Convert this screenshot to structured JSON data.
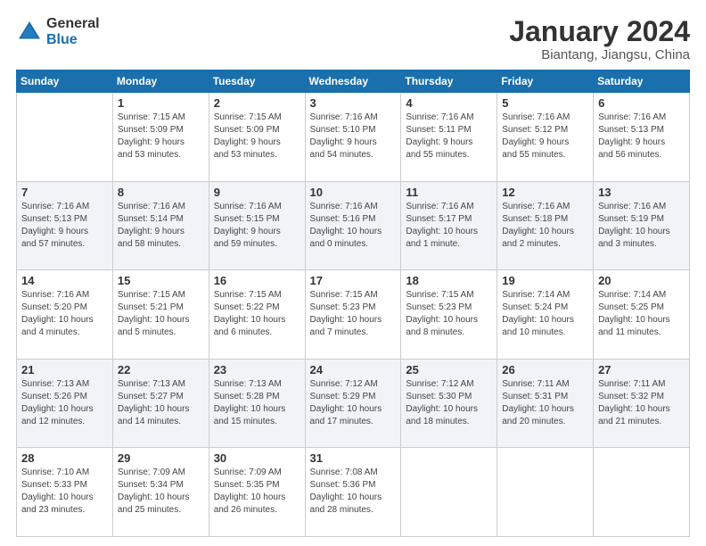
{
  "header": {
    "logo_general": "General",
    "logo_blue": "Blue",
    "month_title": "January 2024",
    "location": "Biantang, Jiangsu, China"
  },
  "days_of_week": [
    "Sunday",
    "Monday",
    "Tuesday",
    "Wednesday",
    "Thursday",
    "Friday",
    "Saturday"
  ],
  "weeks": [
    [
      {
        "day": "",
        "info": ""
      },
      {
        "day": "1",
        "info": "Sunrise: 7:15 AM\nSunset: 5:09 PM\nDaylight: 9 hours\nand 53 minutes."
      },
      {
        "day": "2",
        "info": "Sunrise: 7:15 AM\nSunset: 5:09 PM\nDaylight: 9 hours\nand 53 minutes."
      },
      {
        "day": "3",
        "info": "Sunrise: 7:16 AM\nSunset: 5:10 PM\nDaylight: 9 hours\nand 54 minutes."
      },
      {
        "day": "4",
        "info": "Sunrise: 7:16 AM\nSunset: 5:11 PM\nDaylight: 9 hours\nand 55 minutes."
      },
      {
        "day": "5",
        "info": "Sunrise: 7:16 AM\nSunset: 5:12 PM\nDaylight: 9 hours\nand 55 minutes."
      },
      {
        "day": "6",
        "info": "Sunrise: 7:16 AM\nSunset: 5:13 PM\nDaylight: 9 hours\nand 56 minutes."
      }
    ],
    [
      {
        "day": "7",
        "info": "Sunrise: 7:16 AM\nSunset: 5:13 PM\nDaylight: 9 hours\nand 57 minutes."
      },
      {
        "day": "8",
        "info": "Sunrise: 7:16 AM\nSunset: 5:14 PM\nDaylight: 9 hours\nand 58 minutes."
      },
      {
        "day": "9",
        "info": "Sunrise: 7:16 AM\nSunset: 5:15 PM\nDaylight: 9 hours\nand 59 minutes."
      },
      {
        "day": "10",
        "info": "Sunrise: 7:16 AM\nSunset: 5:16 PM\nDaylight: 10 hours\nand 0 minutes."
      },
      {
        "day": "11",
        "info": "Sunrise: 7:16 AM\nSunset: 5:17 PM\nDaylight: 10 hours\nand 1 minute."
      },
      {
        "day": "12",
        "info": "Sunrise: 7:16 AM\nSunset: 5:18 PM\nDaylight: 10 hours\nand 2 minutes."
      },
      {
        "day": "13",
        "info": "Sunrise: 7:16 AM\nSunset: 5:19 PM\nDaylight: 10 hours\nand 3 minutes."
      }
    ],
    [
      {
        "day": "14",
        "info": "Sunrise: 7:16 AM\nSunset: 5:20 PM\nDaylight: 10 hours\nand 4 minutes."
      },
      {
        "day": "15",
        "info": "Sunrise: 7:15 AM\nSunset: 5:21 PM\nDaylight: 10 hours\nand 5 minutes."
      },
      {
        "day": "16",
        "info": "Sunrise: 7:15 AM\nSunset: 5:22 PM\nDaylight: 10 hours\nand 6 minutes."
      },
      {
        "day": "17",
        "info": "Sunrise: 7:15 AM\nSunset: 5:23 PM\nDaylight: 10 hours\nand 7 minutes."
      },
      {
        "day": "18",
        "info": "Sunrise: 7:15 AM\nSunset: 5:23 PM\nDaylight: 10 hours\nand 8 minutes."
      },
      {
        "day": "19",
        "info": "Sunrise: 7:14 AM\nSunset: 5:24 PM\nDaylight: 10 hours\nand 10 minutes."
      },
      {
        "day": "20",
        "info": "Sunrise: 7:14 AM\nSunset: 5:25 PM\nDaylight: 10 hours\nand 11 minutes."
      }
    ],
    [
      {
        "day": "21",
        "info": "Sunrise: 7:13 AM\nSunset: 5:26 PM\nDaylight: 10 hours\nand 12 minutes."
      },
      {
        "day": "22",
        "info": "Sunrise: 7:13 AM\nSunset: 5:27 PM\nDaylight: 10 hours\nand 14 minutes."
      },
      {
        "day": "23",
        "info": "Sunrise: 7:13 AM\nSunset: 5:28 PM\nDaylight: 10 hours\nand 15 minutes."
      },
      {
        "day": "24",
        "info": "Sunrise: 7:12 AM\nSunset: 5:29 PM\nDaylight: 10 hours\nand 17 minutes."
      },
      {
        "day": "25",
        "info": "Sunrise: 7:12 AM\nSunset: 5:30 PM\nDaylight: 10 hours\nand 18 minutes."
      },
      {
        "day": "26",
        "info": "Sunrise: 7:11 AM\nSunset: 5:31 PM\nDaylight: 10 hours\nand 20 minutes."
      },
      {
        "day": "27",
        "info": "Sunrise: 7:11 AM\nSunset: 5:32 PM\nDaylight: 10 hours\nand 21 minutes."
      }
    ],
    [
      {
        "day": "28",
        "info": "Sunrise: 7:10 AM\nSunset: 5:33 PM\nDaylight: 10 hours\nand 23 minutes."
      },
      {
        "day": "29",
        "info": "Sunrise: 7:09 AM\nSunset: 5:34 PM\nDaylight: 10 hours\nand 25 minutes."
      },
      {
        "day": "30",
        "info": "Sunrise: 7:09 AM\nSunset: 5:35 PM\nDaylight: 10 hours\nand 26 minutes."
      },
      {
        "day": "31",
        "info": "Sunrise: 7:08 AM\nSunset: 5:36 PM\nDaylight: 10 hours\nand 28 minutes."
      },
      {
        "day": "",
        "info": ""
      },
      {
        "day": "",
        "info": ""
      },
      {
        "day": "",
        "info": ""
      }
    ]
  ]
}
